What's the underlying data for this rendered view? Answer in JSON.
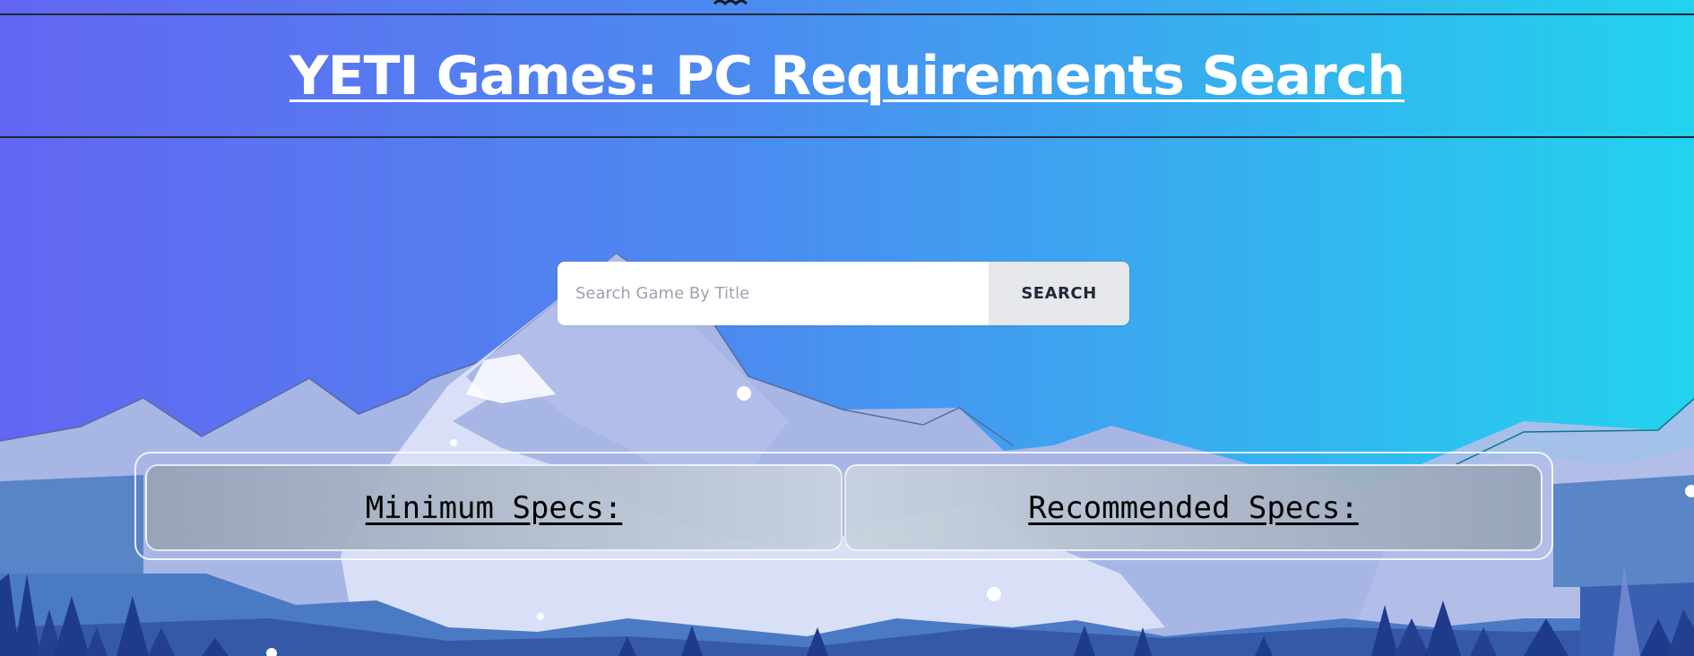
{
  "header": {
    "title": "YETI Games: PC Requirements Search"
  },
  "search": {
    "placeholder": "Search Game By Title",
    "value": "",
    "button_label": "SEARCH"
  },
  "specs": {
    "minimum_label": "Minimum Specs:",
    "recommended_label": "Recommended Specs:"
  },
  "colors": {
    "gradient_start": "#6366f1",
    "gradient_end": "#22d3ee",
    "title_text": "#ffffff",
    "button_bg": "#e5e7eb"
  }
}
